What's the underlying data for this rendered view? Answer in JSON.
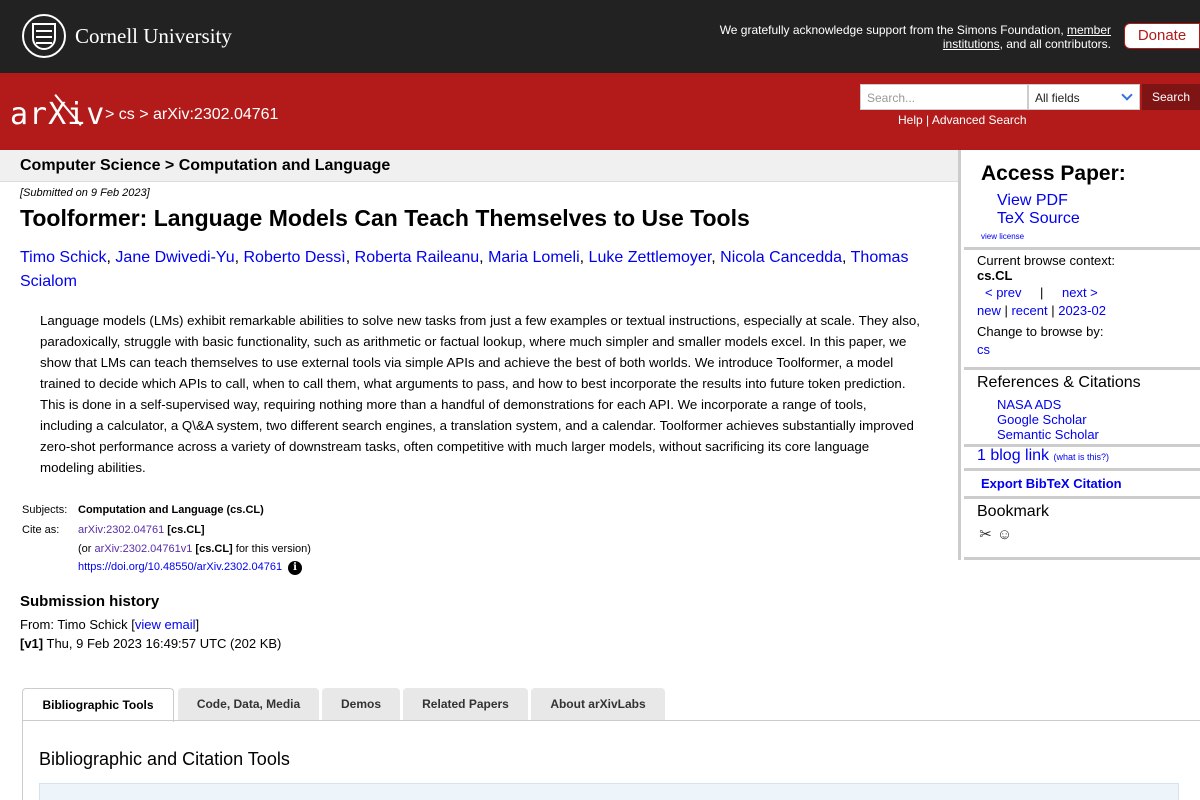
{
  "topbar": {
    "university": "Cornell University",
    "ack_text_1": "We gratefully acknowledge support from the Simons Foundation, ",
    "ack_link": "member institutions",
    "ack_text_2": ", and all contributors.",
    "donate_label": "Donate"
  },
  "header": {
    "logo_text": "arXiv",
    "breadcrumb": "> cs > arXiv:2302.04761",
    "search_placeholder": "Search...",
    "search_field": "All fields",
    "search_button": "Search",
    "help_link": "Help",
    "separator": " | ",
    "advanced_link": "Advanced Search"
  },
  "subheader": "Computer Science > Computation and Language",
  "paper": {
    "submitted": "[Submitted on 9 Feb 2023]",
    "title": "Toolformer: Language Models Can Teach Themselves to Use Tools",
    "authors": [
      "Timo Schick",
      "Jane Dwivedi-Yu",
      "Roberto Dessì",
      "Roberta Raileanu",
      "Maria Lomeli",
      "Luke Zettlemoyer",
      "Nicola Cancedda",
      "Thomas Scialom"
    ],
    "abstract": "Language models (LMs) exhibit remarkable abilities to solve new tasks from just a few examples or textual instructions, especially at scale. They also, paradoxically, struggle with basic functionality, such as arithmetic or factual lookup, where much simpler and smaller models excel. In this paper, we show that LMs can teach themselves to use external tools via simple APIs and achieve the best of both worlds. We introduce Toolformer, a model trained to decide which APIs to call, when to call them, what arguments to pass, and how to best incorporate the results into future token prediction. This is done in a self-supervised way, requiring nothing more than a handful of demonstrations for each API. We incorporate a range of tools, including a calculator, a Q\\&A system, two different search engines, a translation system, and a calendar. Toolformer achieves substantially improved zero-shot performance across a variety of downstream tasks, often competitive with much larger models, without sacrificing its core language modeling abilities."
  },
  "meta": {
    "subjects_label": "Subjects:",
    "subjects_value": "Computation and Language (cs.CL)",
    "cite_label": "Cite as:",
    "cite_id": "arXiv:2302.04761",
    "cite_tag": " [cs.CL]",
    "or_prefix": "(or ",
    "cite_v1": "arXiv:2302.04761v1",
    "cite_v1_tag": " [cs.CL]",
    "cite_v1_suffix": " for this version)",
    "doi": "https://doi.org/10.48550/arXiv.2302.04761"
  },
  "history": {
    "title": "Submission history",
    "from_prefix": "From: Timo Schick [",
    "view_email": "view email",
    "from_suffix": "]",
    "v1_tag": "[v1]",
    "v1_text": " Thu, 9 Feb 2023 16:49:57 UTC (202 KB)"
  },
  "tabs": [
    "Bibliographic Tools",
    "Code, Data, Media",
    "Demos",
    "Related Papers",
    "About arXivLabs"
  ],
  "panel_title": "Bibliographic and Citation Tools",
  "sidebar": {
    "access_title": "Access Paper:",
    "view_pdf": "View PDF",
    "tex_source": "TeX Source",
    "view_license": "view license",
    "browse_context_label": "Current browse context:",
    "browse_context": "cs.CL",
    "prev": "< prev",
    "pipe": "|",
    "next": "next >",
    "new": "new",
    "recent": "recent",
    "month": "2023-02",
    "change_browse": "Change to browse by:",
    "cs": "cs",
    "refs_title": "References & Citations",
    "refs": [
      "NASA ADS",
      "Google Scholar",
      "Semantic Scholar"
    ],
    "blog_link": "1 blog link",
    "what_is_this": "(what is this?)",
    "export_bibtex": "Export BibTeX Citation",
    "bookmark_title": "Bookmark"
  }
}
